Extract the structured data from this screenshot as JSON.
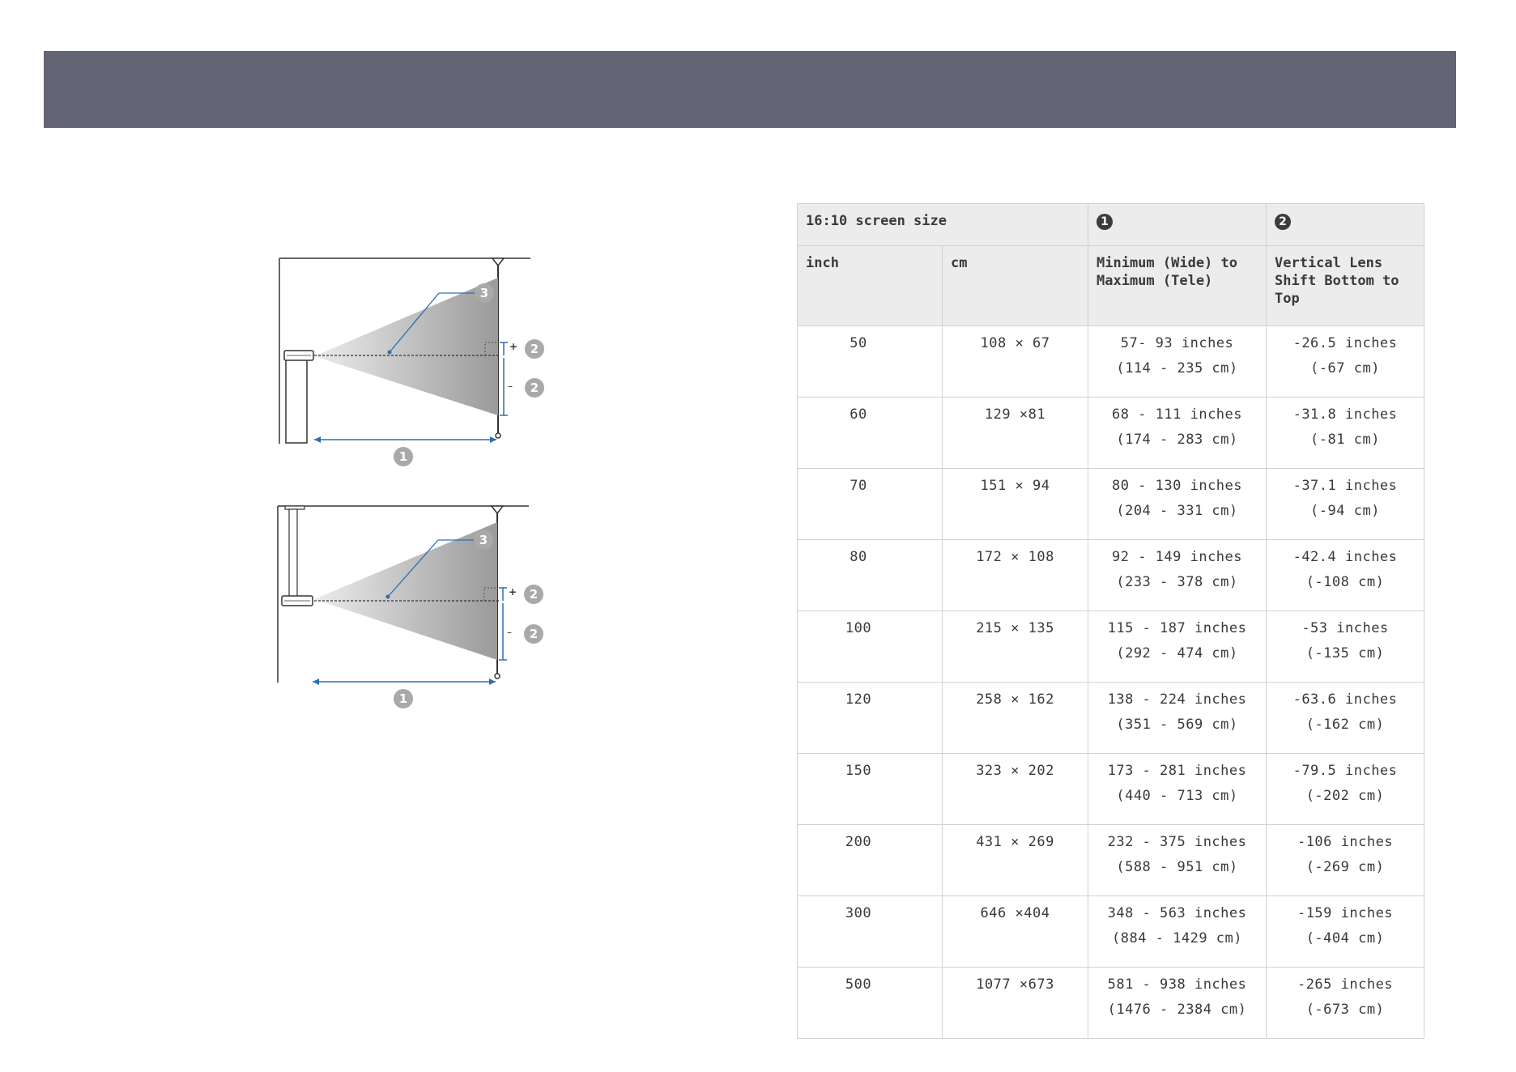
{
  "header": {
    "background": "#636574"
  },
  "diagrams": {
    "callouts": [
      "1",
      "2",
      "3"
    ],
    "signs": {
      "plus": "+",
      "minus": "–"
    }
  },
  "table": {
    "header_row1": {
      "screen_size_label": "16:10 screen size",
      "col3_badge": "1",
      "col4_badge": "2"
    },
    "header_row2": {
      "inch": "inch",
      "cm": "cm",
      "col3": "Minimum (Wide) to Maximum (Tele)",
      "col4": "Vertical Lens Shift Bottom to Top"
    },
    "rows": [
      {
        "inch": "50",
        "cm": "108 × 67",
        "range_in": "57- 93 inches",
        "range_cm": "(114 - 235 cm)",
        "shift_in": "-26.5 inches",
        "shift_cm": "(-67 cm)"
      },
      {
        "inch": "60",
        "cm": "129 ×81",
        "range_in": "68 - 111 inches",
        "range_cm": "(174 - 283 cm)",
        "shift_in": "-31.8 inches",
        "shift_cm": "(-81 cm)"
      },
      {
        "inch": "70",
        "cm": "151 × 94",
        "range_in": "80 - 130 inches",
        "range_cm": "(204 - 331 cm)",
        "shift_in": "-37.1 inches",
        "shift_cm": "(-94 cm)"
      },
      {
        "inch": "80",
        "cm": "172 × 108",
        "range_in": "92 - 149 inches",
        "range_cm": "(233 - 378 cm)",
        "shift_in": "-42.4 inches",
        "shift_cm": "(-108 cm)"
      },
      {
        "inch": "100",
        "cm": "215 × 135",
        "range_in": "115 - 187 inches",
        "range_cm": "(292 - 474 cm)",
        "shift_in": "-53 inches",
        "shift_cm": "(-135 cm)"
      },
      {
        "inch": "120",
        "cm": "258 × 162",
        "range_in": "138 - 224 inches",
        "range_cm": "(351 - 569 cm)",
        "shift_in": "-63.6 inches",
        "shift_cm": "(-162 cm)"
      },
      {
        "inch": "150",
        "cm": "323 × 202",
        "range_in": "173 - 281 inches",
        "range_cm": "(440 - 713 cm)",
        "shift_in": "-79.5 inches",
        "shift_cm": "(-202 cm)"
      },
      {
        "inch": "200",
        "cm": "431 × 269",
        "range_in": "232 - 375 inches",
        "range_cm": "(588 - 951 cm)",
        "shift_in": "-106 inches",
        "shift_cm": "(-269 cm)"
      },
      {
        "inch": "300",
        "cm": "646 ×404",
        "range_in": "348 - 563 inches",
        "range_cm": "(884 - 1429 cm)",
        "shift_in": "-159 inches",
        "shift_cm": "(-404 cm)"
      },
      {
        "inch": "500",
        "cm": "1077 ×673",
        "range_in": "581 - 938 inches",
        "range_cm": "(1476 - 2384 cm)",
        "shift_in": "-265 inches",
        "shift_cm": "(-673 cm)"
      }
    ]
  }
}
